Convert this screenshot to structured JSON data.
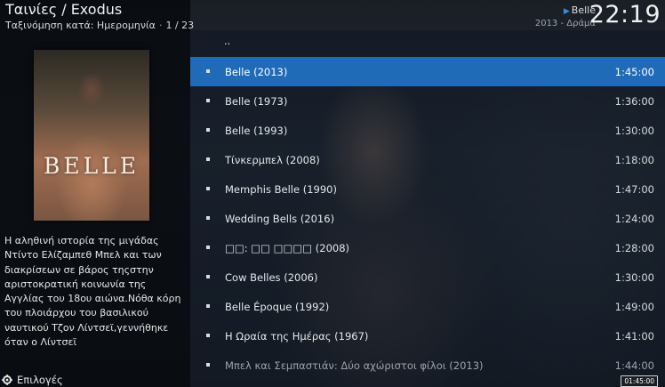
{
  "header": {
    "title": "Ταινίες / Exodus",
    "sort_label": "Ταξινόμηση κατά: Ημερομηνία",
    "position": "1 / 23",
    "now_playing_title": "Belle",
    "now_playing_subtitle": "2013 - Δράμα",
    "clock": "22:19"
  },
  "info": {
    "poster_title": "BELLE",
    "plot": "Η αληθινή ιστορία της μιγάδας Ντίντο Ελίζαμπεθ Μπελ και των διακρίσεων σε βάρος τηςστην αριστοκρατική κοινωνία της Αγγλίας του 18ου αιώνα.Νόθα κόρη του πλοιάρχου του βασιλικού ναυτικού Τζον Λίντσεϊ,γεννήθηκε όταν ο Λίντσεϊ"
  },
  "options_label": "Επιλογές",
  "list": {
    "parent_label": "..",
    "items": [
      {
        "title": "Belle (2013)",
        "duration": "1:45:00"
      },
      {
        "title": "Belle (1973)",
        "duration": "1:36:00"
      },
      {
        "title": "Belle (1993)",
        "duration": "1:30:00"
      },
      {
        "title": "Τίνκερμπελ (2008)",
        "duration": "1:18:00"
      },
      {
        "title": "Memphis Belle (1990)",
        "duration": "1:47:00"
      },
      {
        "title": "Wedding Bells (2016)",
        "duration": "1:24:00"
      },
      {
        "title": "□□: □□ □□□□ (2008)",
        "duration": "1:28:00"
      },
      {
        "title": "Cow Belles (2006)",
        "duration": "1:30:00"
      },
      {
        "title": "Belle Époque (1992)",
        "duration": "1:49:00"
      },
      {
        "title": "Η Ωραία της Ημέρας (1967)",
        "duration": "1:41:00"
      },
      {
        "title": "Μπελ και Σεμπαστιάν: Δύο αχώριστοι φίλοι (2013)",
        "duration": "1:44:00"
      }
    ]
  },
  "badge_duration": "01:45:00",
  "colors": {
    "selection": "#1f6bb8",
    "accent": "#2e8ee8"
  }
}
